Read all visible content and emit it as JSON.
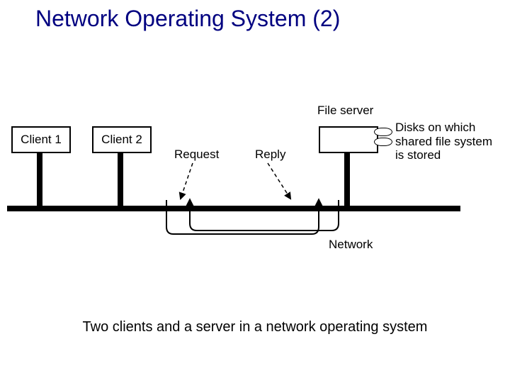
{
  "title": "Network Operating System (2)",
  "caption": "Two clients and a server in a network operating system",
  "diagram": {
    "client1": "Client 1",
    "client2": "Client 2",
    "fileserver_label": "File server",
    "request_label": "Request",
    "reply_label": "Reply",
    "network_label": "Network",
    "disks_label": "Disks on which\nshared file system\nis stored"
  }
}
